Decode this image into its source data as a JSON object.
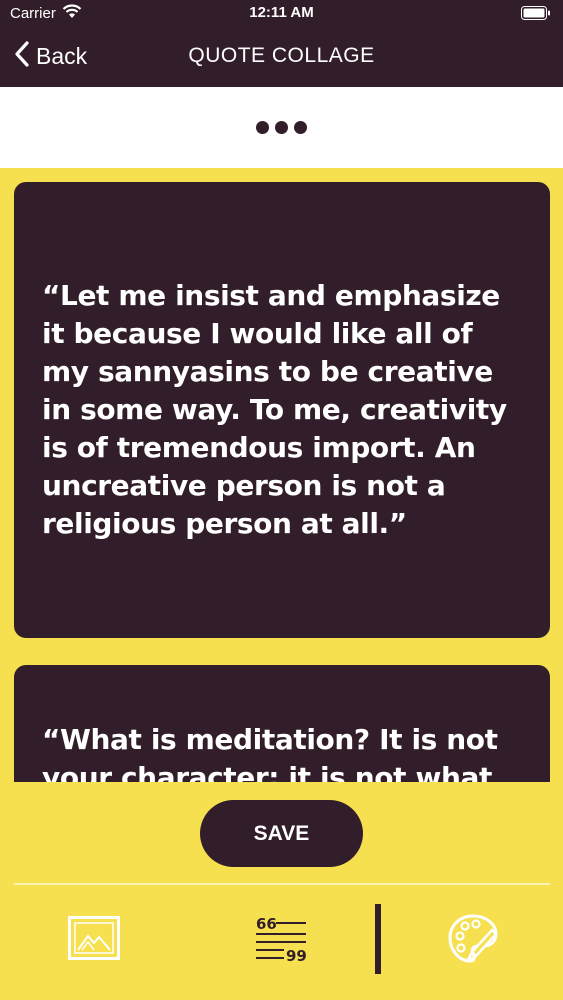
{
  "status_bar": {
    "carrier": "Carrier",
    "time": "12:11 AM"
  },
  "nav": {
    "back_label": "Back",
    "title": "QUOTE COLLAGE"
  },
  "quotes": [
    "“Let me insist and emphasize it because I would like all of my sannyasins to be creative in some way. To me, creativity is of tremendous import. An uncreative person is not a religious person at all.”",
    "“What is meditation? It is not your character; it is not what"
  ],
  "bottom": {
    "save_label": "SAVE"
  },
  "icons": {
    "back": "chevron-left-icon",
    "more": "more-dots-icon",
    "image_tool": "image-icon",
    "text_tool": "quote-text-icon",
    "palette_tool": "palette-icon"
  },
  "colors": {
    "dark": "#321e2a",
    "accent": "#f6e04f",
    "white": "#ffffff"
  }
}
